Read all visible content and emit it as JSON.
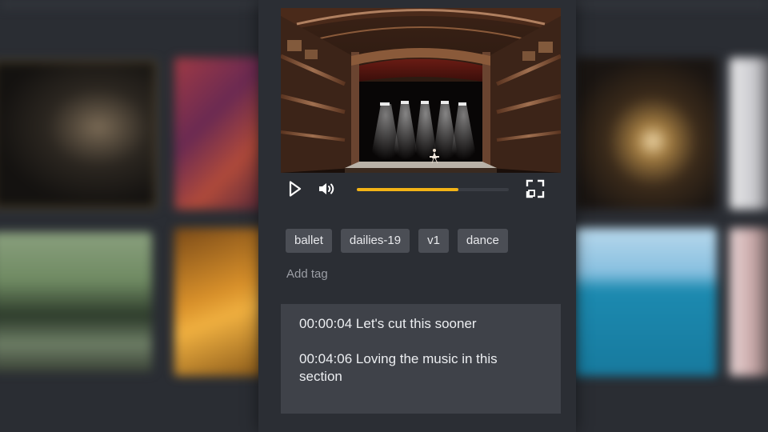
{
  "video": {
    "progress_fraction": 0.67
  },
  "controls": {
    "play_icon": "play-icon",
    "volume_icon": "volume-icon",
    "fullscreen_icon": "fullscreen-icon"
  },
  "tags": [
    "ballet",
    "dailies-19",
    "v1",
    "dance"
  ],
  "add_tag": {
    "placeholder": "Add tag"
  },
  "comments": [
    {
      "timestamp": "00:00:04",
      "text": "Let's cut this sooner"
    },
    {
      "timestamp": "00:04:06",
      "text": "Loving the music in this section"
    }
  ],
  "colors": {
    "accent": "#f2b316",
    "panel": "#2b2e34",
    "comments_bg": "#3f4249",
    "tag_bg": "#4b4e55"
  }
}
